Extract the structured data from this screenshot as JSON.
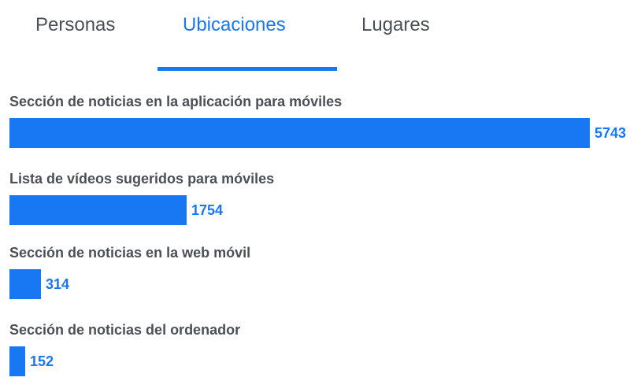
{
  "tabs": [
    {
      "label": "Personas",
      "active": false
    },
    {
      "label": "Ubicaciones",
      "active": true
    },
    {
      "label": "Lugares",
      "active": false
    }
  ],
  "colors": {
    "accent": "#1877f2",
    "text": "#4b4f56"
  },
  "chart_data": {
    "type": "bar",
    "orientation": "horizontal",
    "categories": [
      "Sección de noticias en la aplicación para móviles",
      "Lista de vídeos sugeridos para móviles",
      "Sección de noticias en la web móvil",
      "Sección de noticias del ordenador"
    ],
    "values": [
      5743,
      1754,
      314,
      152
    ],
    "value_labels": [
      "5743",
      "1754",
      "314",
      "152"
    ]
  }
}
